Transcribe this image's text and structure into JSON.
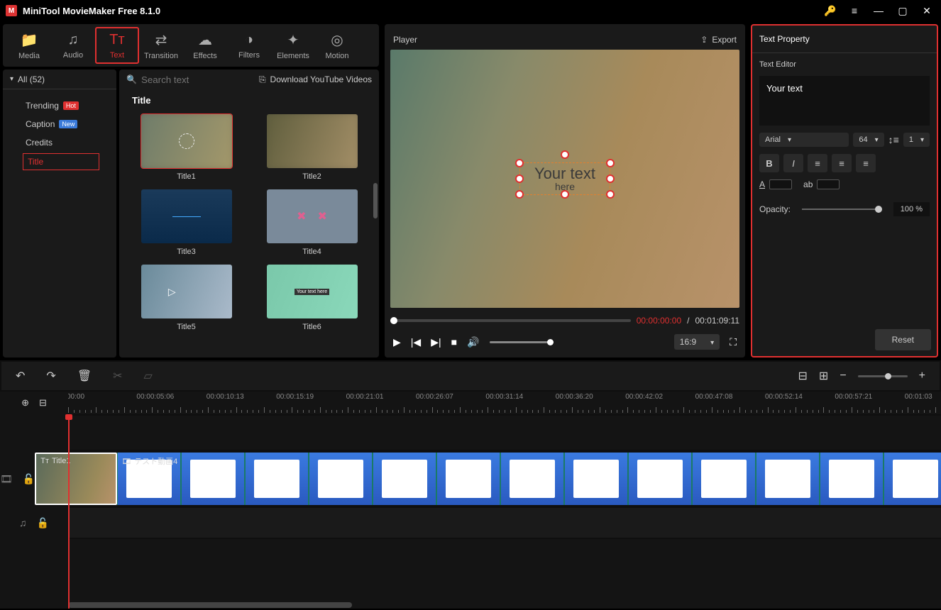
{
  "titlebar": {
    "title": "MiniTool MovieMaker Free 8.1.0"
  },
  "toolbar": {
    "items": [
      {
        "label": "Media",
        "icon": "📁"
      },
      {
        "label": "Audio",
        "icon": "♫"
      },
      {
        "label": "Text",
        "icon": "Tᴛ"
      },
      {
        "label": "Transition",
        "icon": "⇄"
      },
      {
        "label": "Effects",
        "icon": "☁"
      },
      {
        "label": "Filters",
        "icon": "◑"
      },
      {
        "label": "Elements",
        "icon": "✦"
      },
      {
        "label": "Motion",
        "icon": "◎"
      }
    ]
  },
  "sidebar": {
    "all_label": "All (52)",
    "items": [
      {
        "label": "Trending",
        "badge": "Hot",
        "badge_cls": ""
      },
      {
        "label": "Caption",
        "badge": "New",
        "badge_cls": "new"
      },
      {
        "label": "Credits",
        "badge": null
      },
      {
        "label": "Title",
        "badge": null
      }
    ]
  },
  "browser": {
    "search_placeholder": "Search text",
    "download_label": "Download YouTube Videos",
    "section": "Title",
    "thumbs": [
      "Title1",
      "Title2",
      "Title3",
      "Title4",
      "Title5",
      "Title6"
    ],
    "thumb6_text": "Your text here"
  },
  "player": {
    "title": "Player",
    "export": "Export",
    "overlay_main": "Your text",
    "overlay_sub": "here",
    "time_cur": "00:00:00:00",
    "time_sep": " / ",
    "time_total": "00:01:09:11",
    "ratio": "16:9"
  },
  "props": {
    "title": "Text Property",
    "editor_label": "Text Editor",
    "editor_text": "Your text",
    "font": "Arial",
    "size": "64",
    "spacing": "1",
    "opacity_label": "Opacity:",
    "opacity_val": "100 %",
    "reset": "Reset"
  },
  "timeline": {
    "marks": [
      "00:00",
      "00:00:05:06",
      "00:00:10:13",
      "00:00:15:19",
      "00:00:21:01",
      "00:00:26:07",
      "00:00:31:14",
      "00:00:36:20",
      "00:00:42:02",
      "00:00:47:08",
      "00:00:52:14",
      "00:00:57:21",
      "00:01:03"
    ],
    "title_clip": "Title1",
    "video_clip": "テスト動画4"
  }
}
